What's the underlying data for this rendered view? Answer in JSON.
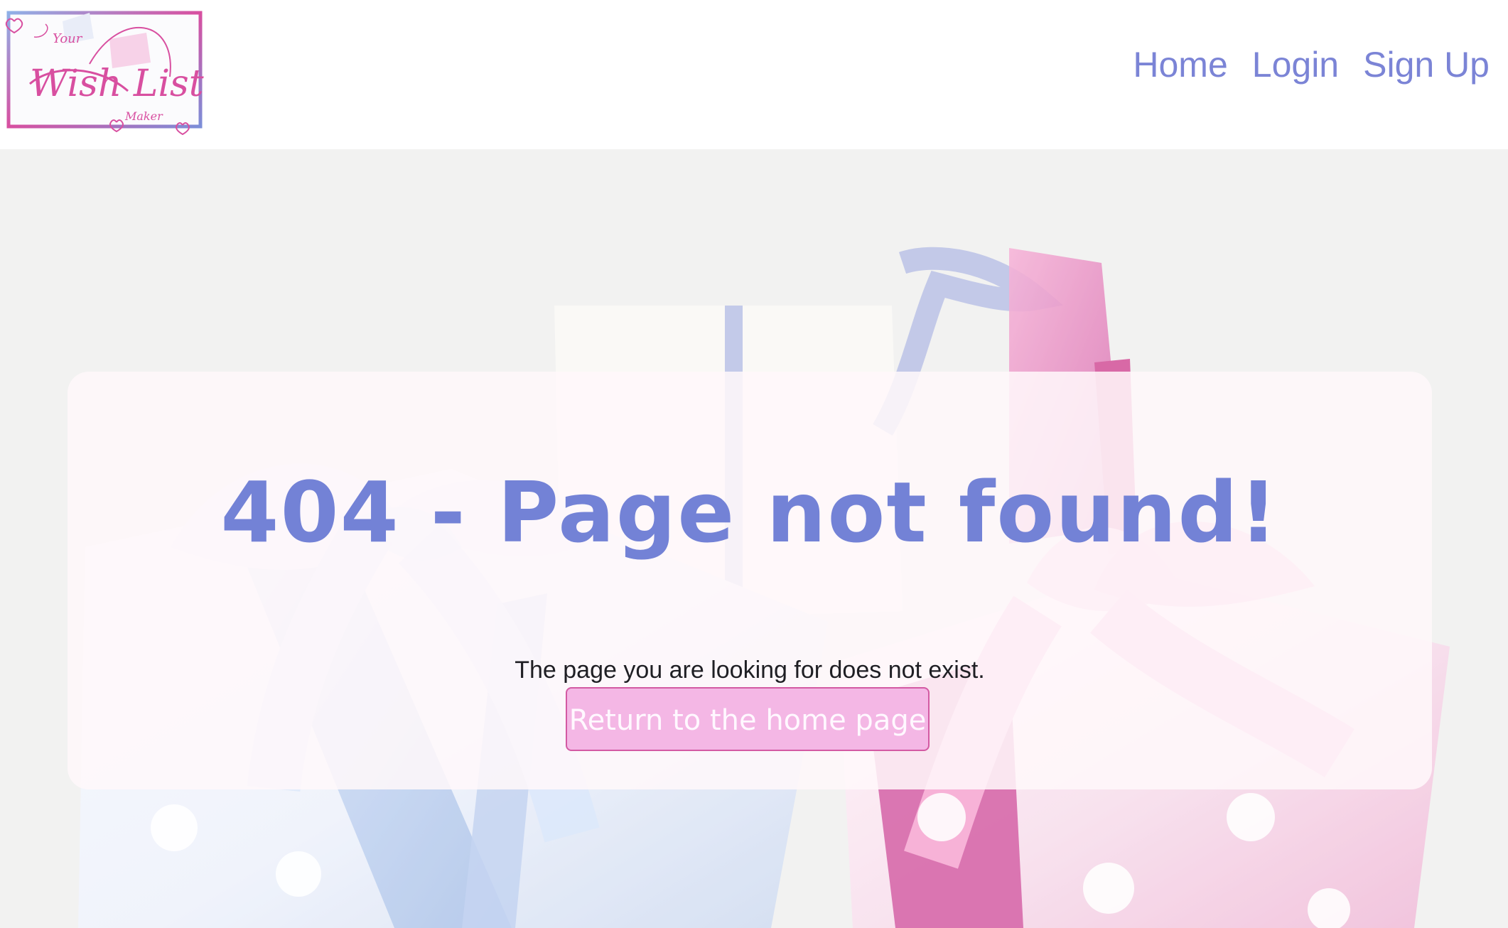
{
  "header": {
    "logo": {
      "line1": "Your",
      "line2": "Wish List",
      "line3": "Maker"
    },
    "nav": [
      {
        "label": "Home"
      },
      {
        "label": "Login"
      },
      {
        "label": "Sign Up"
      }
    ]
  },
  "main": {
    "title": "404 - Page not found!",
    "message": "The page you are looking for does not exist.",
    "button_label": "Return to the home page"
  },
  "colors": {
    "nav_text": "#7b84d6",
    "title_text": "#7382d6",
    "button_bg": "#f4b7e5",
    "button_border": "#d35aa3",
    "pink_accent": "#d84fa0",
    "blue_accent": "#7c8ed8"
  },
  "icons": {
    "logo": "wish-list-maker-logo",
    "gifts": "gift-boxes-illustration"
  }
}
